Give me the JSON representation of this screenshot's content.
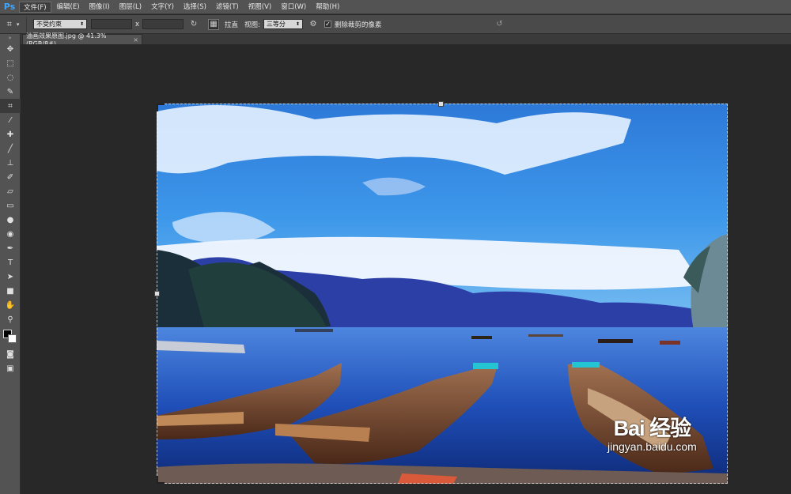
{
  "app": {
    "logo": "Ps"
  },
  "menu": [
    {
      "label": "文件(F)",
      "active": true
    },
    {
      "label": "编辑(E)"
    },
    {
      "label": "图像(I)"
    },
    {
      "label": "图层(L)"
    },
    {
      "label": "文字(Y)"
    },
    {
      "label": "选择(S)"
    },
    {
      "label": "滤镜(T)"
    },
    {
      "label": "视图(V)"
    },
    {
      "label": "窗口(W)"
    },
    {
      "label": "帮助(H)"
    }
  ],
  "options": {
    "tool_icon": "crop-icon",
    "ratio_select": "不受约束",
    "ratio_width": "",
    "ratio_x": "x",
    "ratio_height": "",
    "straighten_label": "拉直",
    "view_label": "视图:",
    "view_select": "三等分",
    "delete_cropped_label": "删除裁剪的像素",
    "delete_cropped_checked": true
  },
  "document": {
    "tab_title": "油画效果原图.jpg @ 41.3%(RGB/8#)",
    "close_glyph": "×"
  },
  "toolbar": {
    "tools": [
      {
        "name": "move-tool",
        "glyph": "✥"
      },
      {
        "name": "marquee-tool",
        "glyph": "⬚"
      },
      {
        "name": "lasso-tool",
        "glyph": "◌"
      },
      {
        "name": "quick-select-tool",
        "glyph": "✎"
      },
      {
        "name": "crop-tool",
        "glyph": "⌗",
        "selected": true
      },
      {
        "name": "eyedropper-tool",
        "glyph": "⁄"
      },
      {
        "name": "healing-brush-tool",
        "glyph": "✚"
      },
      {
        "name": "brush-tool",
        "glyph": "╱"
      },
      {
        "name": "clone-stamp-tool",
        "glyph": "⊥"
      },
      {
        "name": "history-brush-tool",
        "glyph": "✐"
      },
      {
        "name": "eraser-tool",
        "glyph": "▱"
      },
      {
        "name": "gradient-tool",
        "glyph": "▭"
      },
      {
        "name": "blur-tool",
        "glyph": "●"
      },
      {
        "name": "dodge-tool",
        "glyph": "◉"
      },
      {
        "name": "pen-tool",
        "glyph": "✒"
      },
      {
        "name": "type-tool",
        "glyph": "T"
      },
      {
        "name": "path-select-tool",
        "glyph": "➤"
      },
      {
        "name": "shape-tool",
        "glyph": "■"
      },
      {
        "name": "hand-tool",
        "glyph": "✋"
      },
      {
        "name": "zoom-tool",
        "glyph": "⚲"
      }
    ],
    "extra_tools": [
      {
        "name": "quick-mask-tool",
        "glyph": "◙"
      },
      {
        "name": "screen-mode-tool",
        "glyph": "▣"
      }
    ]
  },
  "watermark": {
    "logo": "Bai 经验",
    "url": "jingyan.baidu.com"
  }
}
